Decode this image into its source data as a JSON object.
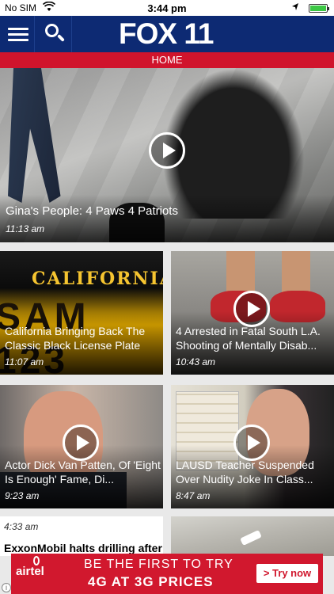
{
  "status_bar": {
    "carrier": "No SIM",
    "time": "3:44 pm"
  },
  "header": {
    "logo": "FOX 11",
    "section": "HOME"
  },
  "hero": {
    "title": "Gina's People: 4 Paws 4 Patriots",
    "time": "11:13 am"
  },
  "cards": [
    {
      "title": "California Bringing Back The Classic Black License Plate",
      "time": "11:07 am",
      "plate_top": "CALIFORNIA",
      "plate_bottom": "SAM 123"
    },
    {
      "title": "4 Arrested in Fatal South L.A. Shooting of Mentally Disab...",
      "time": "10:43 am"
    },
    {
      "title": "Actor Dick Van Patten, Of 'Eight Is Enough' Fame, Di...",
      "time": "9:23 am"
    },
    {
      "title": "LAUSD Teacher Suspended Over Nudity Joke In Class...",
      "time": "8:47 am"
    }
  ],
  "bottom_tile": {
    "time": "4:33 am",
    "title": "ExxonMobil halts drilling after"
  },
  "ad": {
    "brand": "airtel",
    "headline_1": "BE THE FIRST TO TRY",
    "headline_2": "4G AT 3G PRICES",
    "cta": "> Try now",
    "info": "i"
  },
  "icons": {
    "menu": "hamburger-icon",
    "search": "search-icon",
    "play": "play-icon",
    "wifi": "wifi-icon",
    "location": "location-arrow-icon",
    "battery": "battery-icon",
    "info": "info-icon"
  },
  "colors": {
    "nav": "#0d2a73",
    "section_bar": "#d0142c",
    "ad": "#d1182e"
  }
}
